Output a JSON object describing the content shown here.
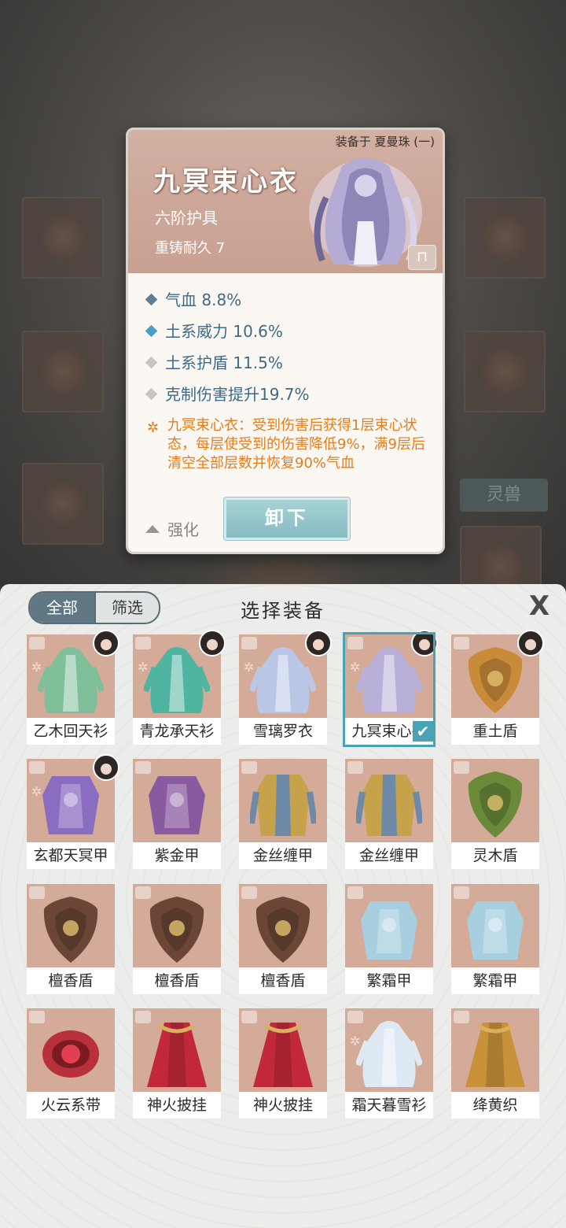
{
  "background": {
    "tag_label": "灵兽"
  },
  "detail": {
    "equipped_to": "装备于 夏曼珠 (一)",
    "name": "九冥束心衣",
    "tier": "六阶护具",
    "durability": "重铸耐久 7",
    "stats": [
      {
        "text": "气血 8.8%",
        "color": "#5d7f96"
      },
      {
        "text": "土系威力 10.6%",
        "color": "#4a9ec5"
      },
      {
        "text": "土系护盾 11.5%",
        "color": "#c9c5c2"
      },
      {
        "text": "克制伤害提升19.7%",
        "color": "#c9c5c2"
      }
    ],
    "effect_icon": "swirl-icon",
    "effect": "九冥束心衣：受到伤害后获得1层束心状态，每层使受到的伤害降低9%，满9层后清空全部层数并恢复90%气血",
    "upgrade_label": "强化",
    "unequip_label": "卸下"
  },
  "panel": {
    "tab_all": "全部",
    "tab_filter": "筛选",
    "title": "选择装备",
    "close": "X",
    "items": [
      {
        "name": "乙木回天衫",
        "art": "robe",
        "color": "#7fbf9a",
        "set": true,
        "avatar": true
      },
      {
        "name": "青龙承天衫",
        "art": "robe",
        "color": "#4fb4a0",
        "set": true,
        "avatar": true
      },
      {
        "name": "雪璃罗衣",
        "art": "robe",
        "color": "#b9c6e6",
        "set": true,
        "avatar": true
      },
      {
        "name": "九冥束心衣",
        "art": "robe",
        "color": "#b8b0d8",
        "set": true,
        "avatar": true,
        "selected": true
      },
      {
        "name": "重土盾",
        "art": "shield",
        "color": "#c98a3a",
        "set": false,
        "avatar": true
      },
      {
        "name": "玄都天冥甲",
        "art": "armor",
        "color": "#8a6cc0",
        "set": true,
        "avatar": true
      },
      {
        "name": "紫金甲",
        "art": "armor",
        "color": "#8a5aa0",
        "set": false,
        "avatar": false
      },
      {
        "name": "金丝缠甲",
        "art": "vest",
        "color": "#c6a24a",
        "set": false,
        "avatar": false
      },
      {
        "name": "金丝缠甲",
        "art": "vest",
        "color": "#c6a24a",
        "set": false,
        "avatar": false
      },
      {
        "name": "灵木盾",
        "art": "shield",
        "color": "#6a8a3a",
        "set": false,
        "avatar": false
      },
      {
        "name": "檀香盾",
        "art": "shield",
        "color": "#6b4636",
        "set": false,
        "avatar": false
      },
      {
        "name": "檀香盾",
        "art": "shield",
        "color": "#6b4636",
        "set": false,
        "avatar": false
      },
      {
        "name": "檀香盾",
        "art": "shield",
        "color": "#6b4636",
        "set": false,
        "avatar": false
      },
      {
        "name": "繁霜甲",
        "art": "armor",
        "color": "#a8cfe0",
        "set": false,
        "avatar": false
      },
      {
        "name": "繁霜甲",
        "art": "armor",
        "color": "#a8cfe0",
        "set": false,
        "avatar": false
      },
      {
        "name": "火云系带",
        "art": "belt",
        "color": "#b8303a",
        "set": false,
        "avatar": false
      },
      {
        "name": "神火披挂",
        "art": "cape",
        "color": "#c2283a",
        "set": false,
        "avatar": false
      },
      {
        "name": "神火披挂",
        "art": "cape",
        "color": "#c2283a",
        "set": false,
        "avatar": false
      },
      {
        "name": "霜天暮雪衫",
        "art": "robe",
        "color": "#dfe9f3",
        "set": true,
        "avatar": false
      },
      {
        "name": "绛黄织",
        "art": "cape",
        "color": "#c7923a",
        "set": false,
        "avatar": false
      }
    ]
  }
}
